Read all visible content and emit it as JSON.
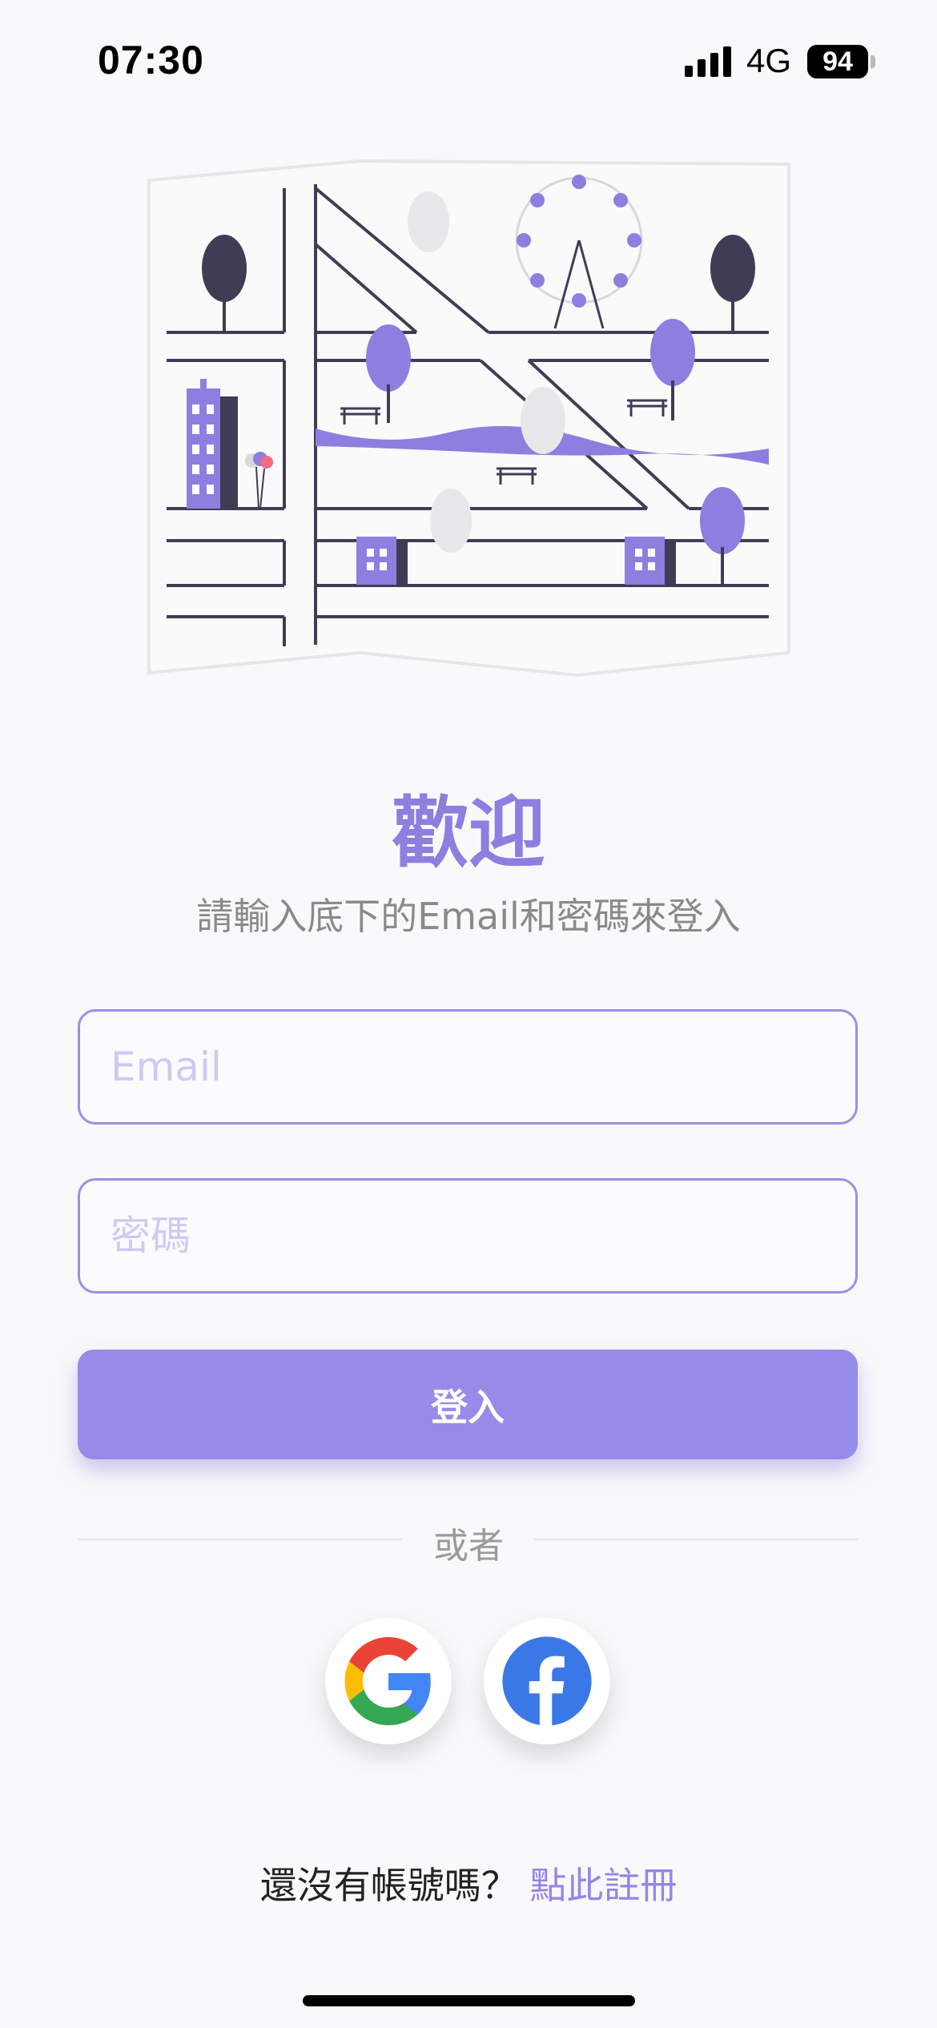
{
  "status_bar": {
    "time": "07:30",
    "network": "4G",
    "battery": "94"
  },
  "welcome": {
    "title": "歡迎",
    "subtitle": "請輸入底下的Email和密碼來登入"
  },
  "form": {
    "email_placeholder": "Email",
    "email_value": "",
    "password_placeholder": "密碼",
    "password_value": "",
    "login_label": "登入"
  },
  "divider": {
    "label": "或者"
  },
  "social": [
    {
      "icon": "google-icon"
    },
    {
      "icon": "facebook-icon"
    }
  ],
  "signup": {
    "prompt": "還沒有帳號嗎？",
    "link": "點此註冊"
  },
  "colors": {
    "accent": "#978be9",
    "facebook": "#3b78e7",
    "background": "#f9f9fb"
  }
}
